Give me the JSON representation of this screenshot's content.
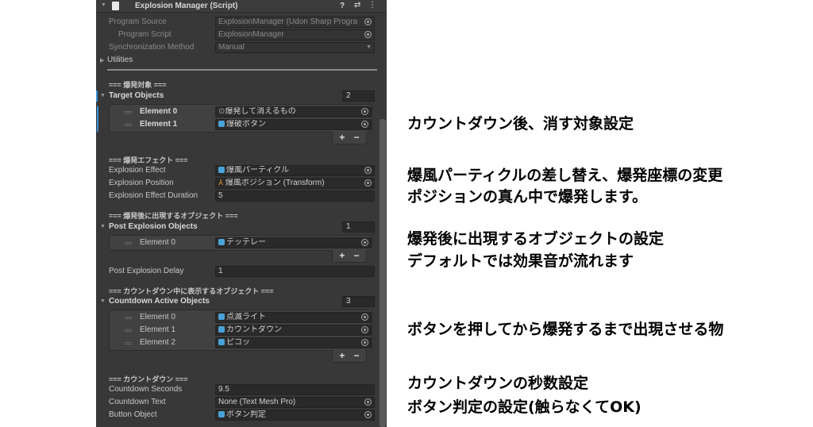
{
  "component": {
    "title": "Explosion Manager (Script)"
  },
  "header_fields": {
    "program_source_label": "Program Source",
    "program_source_value": "ExplosionManager (Udon Sharp Progra",
    "program_script_label": "Program Script",
    "program_script_value": "ExplosionManager",
    "sync_label": "Synchronization Method",
    "sync_value": "Manual",
    "utilities_label": "Utilities"
  },
  "target": {
    "section": "=== 爆発対象 ===",
    "label": "Target Objects",
    "count": "2",
    "elements": [
      {
        "label": "Element 0",
        "value": "爆発して消えるもの"
      },
      {
        "label": "Element 1",
        "value": "爆破ボタン"
      }
    ]
  },
  "effect": {
    "section": "=== 爆発エフェクト ===",
    "effect_label": "Explosion Effect",
    "effect_value": "爆風パーティクル",
    "position_label": "Explosion Position",
    "position_value": "爆風ポジション (Transform)",
    "duration_label": "Explosion Effect Duration",
    "duration_value": "5"
  },
  "post": {
    "section": "=== 爆発後に出現するオブジェクト ===",
    "label": "Post Explosion Objects",
    "count": "1",
    "elements": [
      {
        "label": "Element 0",
        "value": "テッテレー"
      }
    ],
    "delay_label": "Post Explosion Delay",
    "delay_value": "1"
  },
  "countdown_objects": {
    "section": "=== カウントダウン中に表示するオブジェクト ===",
    "label": "Countdown Active Objects",
    "count": "3",
    "elements": [
      {
        "label": "Element 0",
        "value": "点滅ライト"
      },
      {
        "label": "Element 1",
        "value": "カウントダウン"
      },
      {
        "label": "Element 2",
        "value": "ピコッ"
      }
    ]
  },
  "countdown": {
    "section": "=== カウントダウン ===",
    "seconds_label": "Countdown Seconds",
    "seconds_value": "9.5",
    "text_label": "Countdown Text",
    "text_value": "None (Text Mesh Pro)",
    "button_label": "Button Object",
    "button_value": "ボタン判定"
  },
  "list_buttons": "+ −",
  "notes": [
    "カウントダウン後、消す対象設定",
    "爆風パーティクルの差し替え、爆発座標の変更",
    "ポジションの真ん中で爆発します。",
    "爆発後に出現するオブジェクトの設定",
    "デフォルトでは効果音が流れます",
    "ボタンを押してから爆発するまで出現させる物",
    "カウントダウンの秒数設定",
    "ボタン判定の設定(触らなくてOK)"
  ]
}
